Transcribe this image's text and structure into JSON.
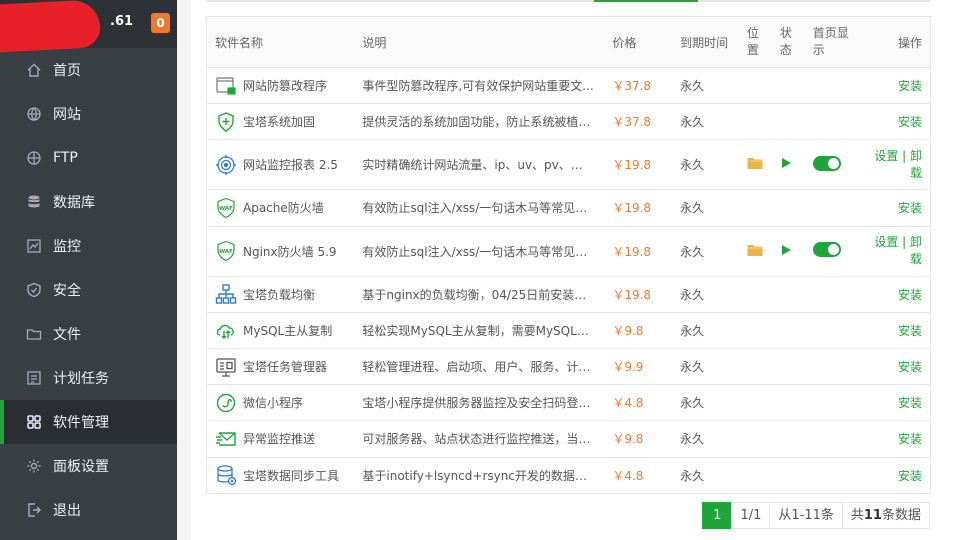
{
  "header": {
    "ip_suffix": ".61",
    "badge_count": "0"
  },
  "nav": [
    {
      "label": "首页",
      "icon": "home-icon"
    },
    {
      "label": "网站",
      "icon": "globe-icon"
    },
    {
      "label": "FTP",
      "icon": "ftp-globe-icon"
    },
    {
      "label": "数据库",
      "icon": "database-icon"
    },
    {
      "label": "监控",
      "icon": "monitor-icon"
    },
    {
      "label": "安全",
      "icon": "shield-icon"
    },
    {
      "label": "文件",
      "icon": "folder-icon"
    },
    {
      "label": "计划任务",
      "icon": "clock-icon"
    },
    {
      "label": "软件管理",
      "icon": "grid-icon",
      "active": true
    },
    {
      "label": "面板设置",
      "icon": "gear-icon"
    },
    {
      "label": "退出",
      "icon": "logout-icon"
    }
  ],
  "table": {
    "headers": {
      "name": "软件名称",
      "desc": "说明",
      "price": "价格",
      "expire": "到期时间",
      "position": "位置",
      "status": "状态",
      "home": "首页显示",
      "action": "操作"
    },
    "rows": [
      {
        "name": "网站防篡改程序",
        "desc": "事件型防篡改程序,可有效保护网站重要文...",
        "price": "￥37.8",
        "expire": "永久",
        "action": "安装",
        "icon": "tamper-icon"
      },
      {
        "name": "宝塔系统加固",
        "desc": "提供灵活的系统加固功能，防止系统被植入...",
        "price": "￥37.8",
        "expire": "永久",
        "action": "安装",
        "icon": "shield-plus-icon"
      },
      {
        "name": "网站监控报表 2.5",
        "desc": "实时精确统计网站流量、ip、uv、pv、请求、...",
        "price": "￥19.8",
        "expire": "永久",
        "action": "设置 | 卸载",
        "installed": true,
        "icon": "target-icon"
      },
      {
        "name": "Apache防火墙",
        "desc": "有效防止sql注入/xss/一句话木马等常见渗...",
        "price": "￥19.8",
        "expire": "永久",
        "action": "安装",
        "icon": "waf-icon"
      },
      {
        "name": "Nginx防火墙 5.9",
        "desc": "有效防止sql注入/xss/一句话木马等常见渗...",
        "price": "￥19.8",
        "expire": "永久",
        "action": "设置 | 卸载",
        "installed": true,
        "icon": "waf-icon"
      },
      {
        "name": "宝塔负载均衡",
        "desc": "基于nginx的负载均衡，04/25日前安装的面...",
        "price": "￥19.8",
        "expire": "永久",
        "action": "安装",
        "icon": "network-icon"
      },
      {
        "name": "MySQL主从复制",
        "desc": "轻松实现MySQL主从复制，需要MySQL5.5...",
        "price": "￥9.8",
        "expire": "永久",
        "action": "安装",
        "icon": "cloud-sync-icon"
      },
      {
        "name": "宝塔任务管理器",
        "desc": "轻松管理进程、启动项、用户、服务、计划任...",
        "price": "￥9.9",
        "expire": "永久",
        "action": "安装",
        "icon": "task-manager-icon"
      },
      {
        "name": "微信小程序",
        "desc": "宝塔小程序提供服务器监控及安全扫码登录...",
        "price": "￥4.8",
        "expire": "永久",
        "action": "安装",
        "icon": "wechat-icon"
      },
      {
        "name": "异常监控推送",
        "desc": "可对服务器、站点状态进行监控推送，当前...",
        "price": "￥9.8",
        "expire": "永久",
        "action": "安装",
        "icon": "mail-push-icon"
      },
      {
        "name": "宝塔数据同步工具",
        "desc": "基于inotify+lsyncd+rsync开发的数据同步工...",
        "price": "￥4.8",
        "expire": "永久",
        "action": "安装",
        "icon": "db-sync-icon"
      }
    ]
  },
  "pager": {
    "current": "1",
    "pages": "1/1",
    "range": "从1-11条",
    "total_prefix": "共",
    "total_count": "11",
    "total_suffix": "条数据"
  },
  "colors": {
    "accent": "#20a53a",
    "price": "#f0782c",
    "sidebar": "#3a3f44"
  }
}
